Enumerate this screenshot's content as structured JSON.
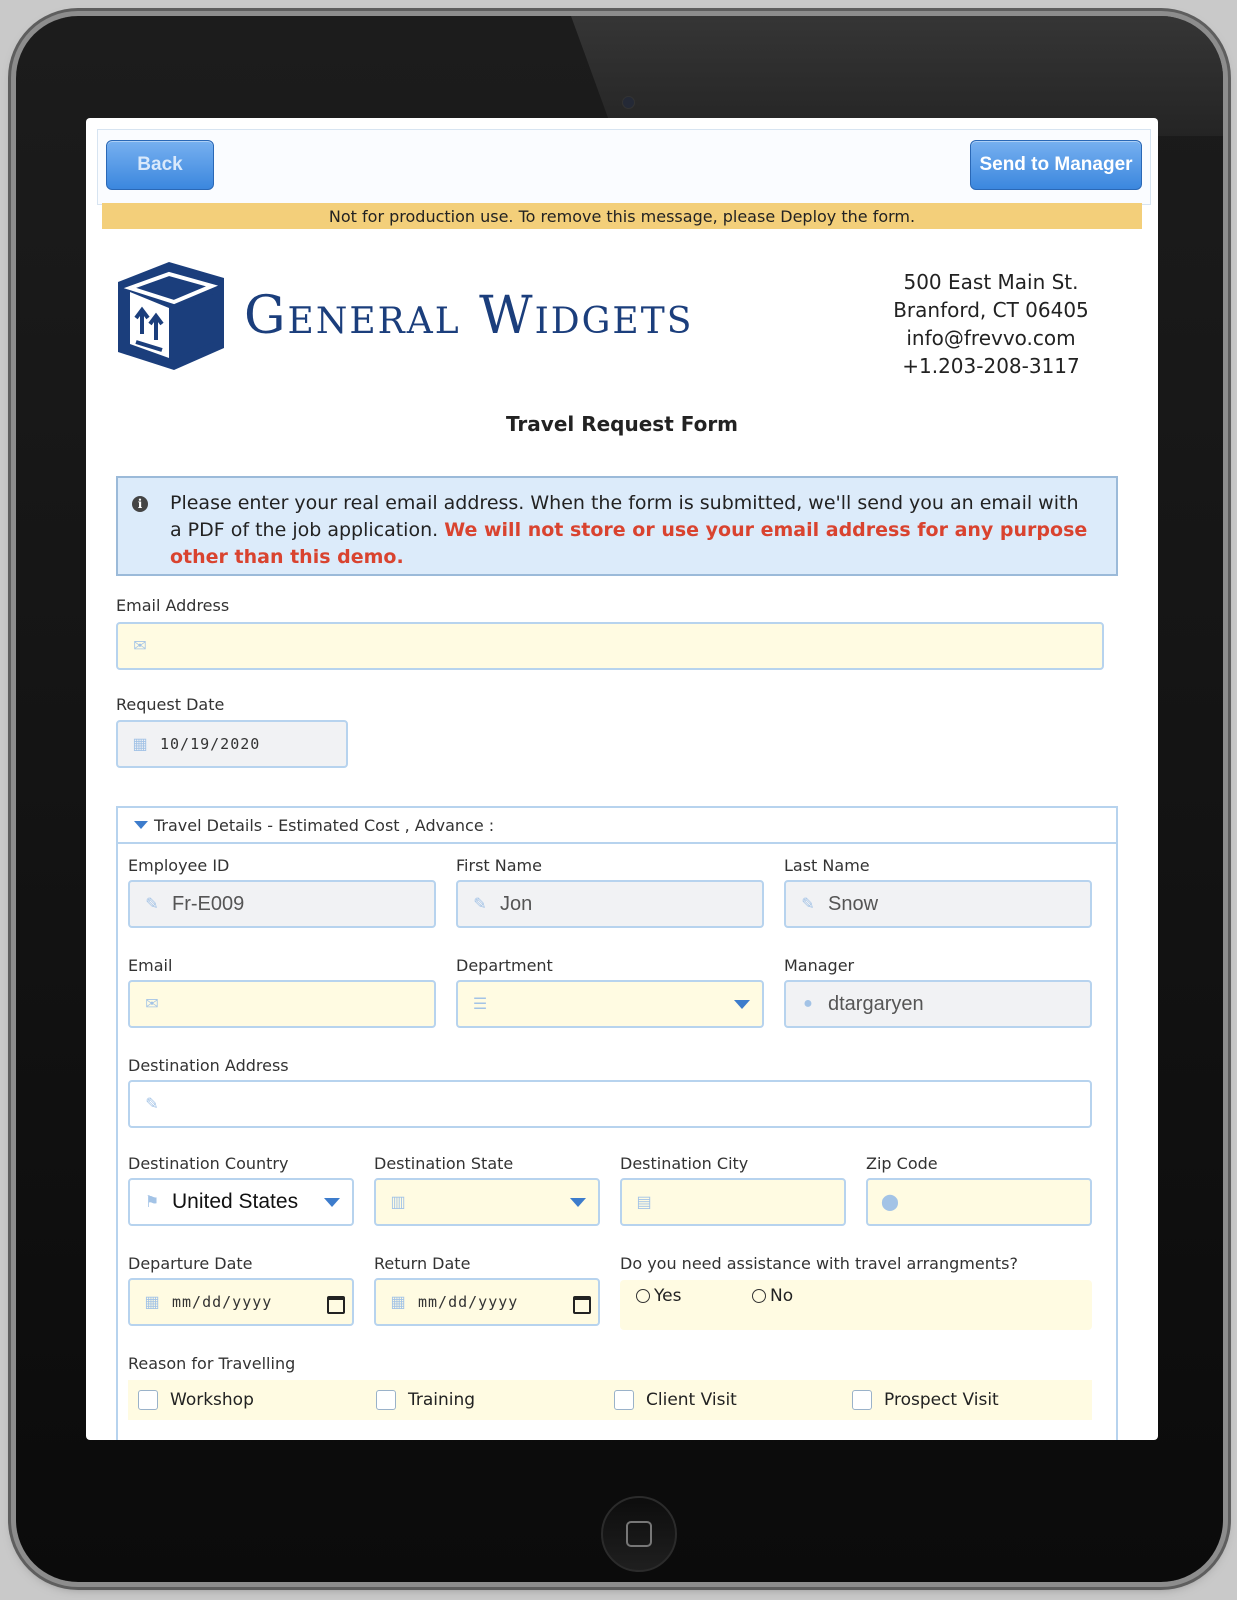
{
  "toolbar": {
    "back_label": "Back",
    "send_label": "Send to Manager"
  },
  "warning_text": "Not for production use. To remove this message, please Deploy the form.",
  "company": {
    "name": "General Widgets",
    "address": [
      "500 East Main St.",
      "Branford, CT 06405",
      "info@frevvo.com",
      "+1.203-208-3117"
    ]
  },
  "form_title": "Travel Request Form",
  "info": {
    "text": "Please enter your real email address. When the form is submitted, we'll send you an email with a PDF of the job application. ",
    "highlight": "We will not store or use your email address for any purpose other than this demo."
  },
  "fields": {
    "email_address": {
      "label": "Email Address",
      "value": ""
    },
    "request_date": {
      "label": "Request Date",
      "value": "10/19/2020"
    }
  },
  "section": {
    "title": "Travel Details - Estimated Cost , Advance :",
    "employee_id": {
      "label": "Employee ID",
      "value": "Fr-E009"
    },
    "first_name": {
      "label": "First Name",
      "value": "Jon"
    },
    "last_name": {
      "label": "Last Name",
      "value": "Snow"
    },
    "email": {
      "label": "Email",
      "value": ""
    },
    "department": {
      "label": "Department",
      "value": ""
    },
    "manager": {
      "label": "Manager",
      "value": "dtargaryen"
    },
    "destination_address": {
      "label": "Destination Address",
      "value": ""
    },
    "destination_country": {
      "label": "Destination Country",
      "value": "United States"
    },
    "destination_state": {
      "label": "Destination State",
      "value": ""
    },
    "destination_city": {
      "label": "Destination City",
      "value": ""
    },
    "zip_code": {
      "label": "Zip Code",
      "value": ""
    },
    "departure_date": {
      "label": "Departure Date",
      "placeholder": "mm/dd/yyyy"
    },
    "return_date": {
      "label": "Return Date",
      "placeholder": "mm/dd/yyyy"
    },
    "assistance": {
      "label": "Do you need assistance with travel arrangments?",
      "options": [
        "Yes",
        "No"
      ]
    },
    "reason": {
      "label": "Reason for Travelling",
      "options": [
        "Workshop",
        "Training",
        "Client Visit",
        "Prospect Visit"
      ]
    }
  },
  "colors": {
    "accent": "#3b87de",
    "warning_bg": "#f3cf7a",
    "highlight_red": "#d9432f",
    "field_yellow": "#fffbe2"
  }
}
